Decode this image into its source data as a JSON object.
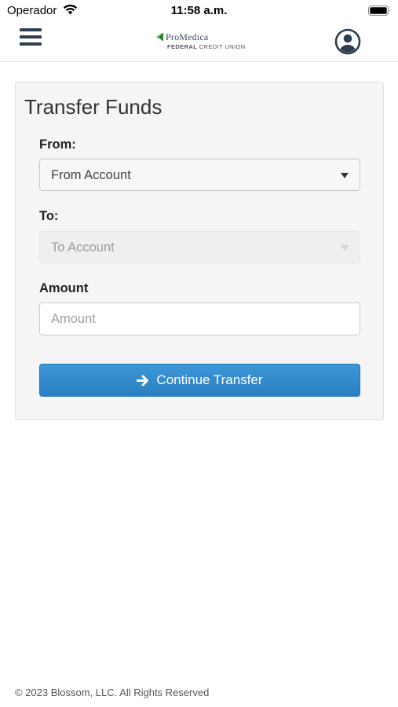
{
  "status_bar": {
    "carrier": "Operador",
    "time": "11:58 a.m.",
    "icons": [
      "wifi-icon",
      "battery-icon"
    ]
  },
  "navbar": {
    "menu_icon": "hamburger-menu-icon",
    "logo": {
      "name": "ProMedica",
      "sub_bold": "FEDERAL",
      "sub_rest": "CREDIT UNION",
      "mark_color": "#4caf50"
    },
    "profile_icon": "user-circle-icon"
  },
  "transfer": {
    "title": "Transfer Funds",
    "from": {
      "label": "From:",
      "value": "From Account",
      "enabled": true
    },
    "to": {
      "label": "To:",
      "value": "To Account",
      "enabled": false
    },
    "amount": {
      "label": "Amount",
      "placeholder": "Amount",
      "value": ""
    },
    "continue_button": {
      "label": "Continue Transfer",
      "icon": "arrow-right-icon",
      "color": "#2f86c9"
    }
  },
  "footer": {
    "copyright": "© 2023 Blossom, LLC. All Rights Reserved"
  }
}
